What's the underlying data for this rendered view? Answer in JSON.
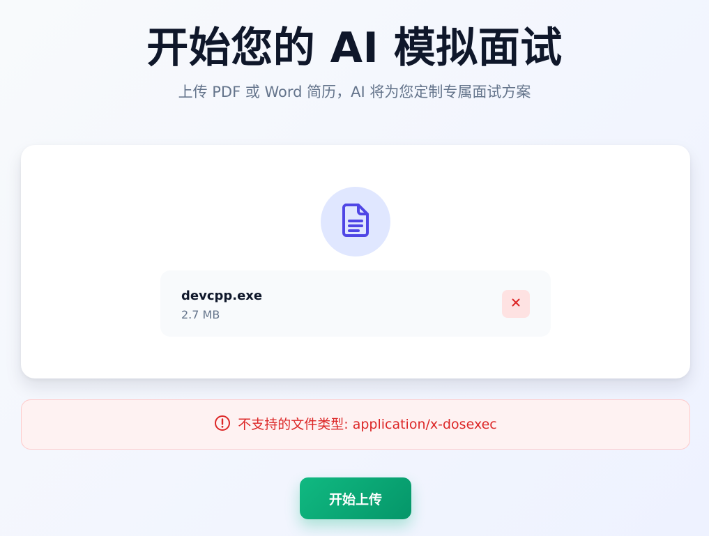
{
  "header": {
    "title": "开始您的 AI 模拟面试",
    "subtitle": "上传 PDF 或 Word 简历，AI 将为您定制专属面试方案"
  },
  "upload": {
    "icon": "document-icon",
    "file": {
      "name": "devcpp.exe",
      "size": "2.7 MB"
    },
    "remove_icon": "close-icon"
  },
  "error": {
    "icon": "alert-circle-icon",
    "message": "不支持的文件类型: application/x-dosexec"
  },
  "actions": {
    "upload_label": "开始上传"
  },
  "colors": {
    "accent": "#4f46e5",
    "icon_bg": "#e0e7ff",
    "error": "#dc2626",
    "error_bg": "#fef2f2",
    "success_start": "#10b981",
    "success_end": "#059669"
  }
}
